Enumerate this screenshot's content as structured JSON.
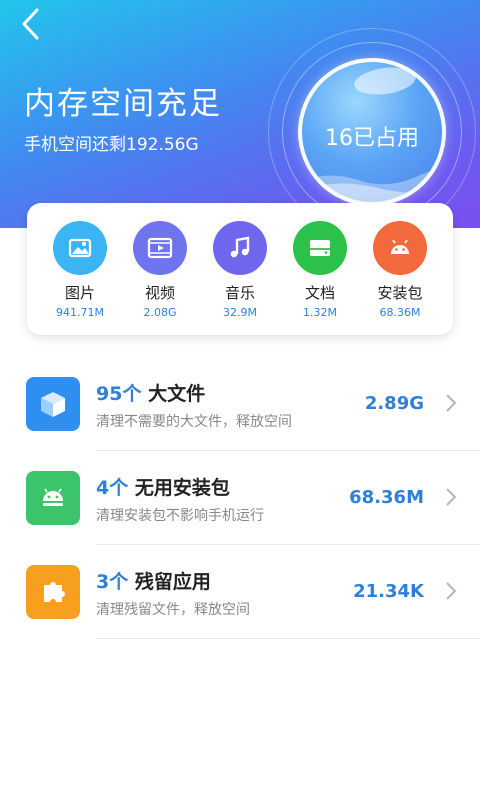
{
  "header": {
    "title": "内存空间充足",
    "subtitle": "手机空间还剩192.56G",
    "gauge_label": "16已占用"
  },
  "categories": [
    {
      "name": "图片",
      "size": "941.71M",
      "icon": "image-icon",
      "color": "#3ab4f2"
    },
    {
      "name": "视频",
      "size": "2.08G",
      "icon": "video-icon",
      "color": "#6f73ee"
    },
    {
      "name": "音乐",
      "size": "32.9M",
      "icon": "music-icon",
      "color": "#6e66ec"
    },
    {
      "name": "文档",
      "size": "1.32M",
      "icon": "document-icon",
      "color": "#2cc14a"
    },
    {
      "name": "安装包",
      "size": "68.36M",
      "icon": "android-icon",
      "color": "#f26a3c"
    }
  ],
  "items": [
    {
      "count": "95个",
      "title": "大文件",
      "desc": "清理不需要的大文件，释放空间",
      "size": "2.89G",
      "icon": "cube-icon",
      "color": "#2f8ff0"
    },
    {
      "count": "4个",
      "title": "无用安装包",
      "desc": "清理安装包不影响手机运行",
      "size": "68.36M",
      "icon": "android-icon",
      "color": "#3cc46a"
    },
    {
      "count": "3个",
      "title": "残留应用",
      "desc": "清理残留文件，释放空间",
      "size": "21.34K",
      "icon": "puzzle-icon",
      "color": "#f7a020"
    }
  ],
  "colors": {
    "accent": "#2e7fd8"
  }
}
